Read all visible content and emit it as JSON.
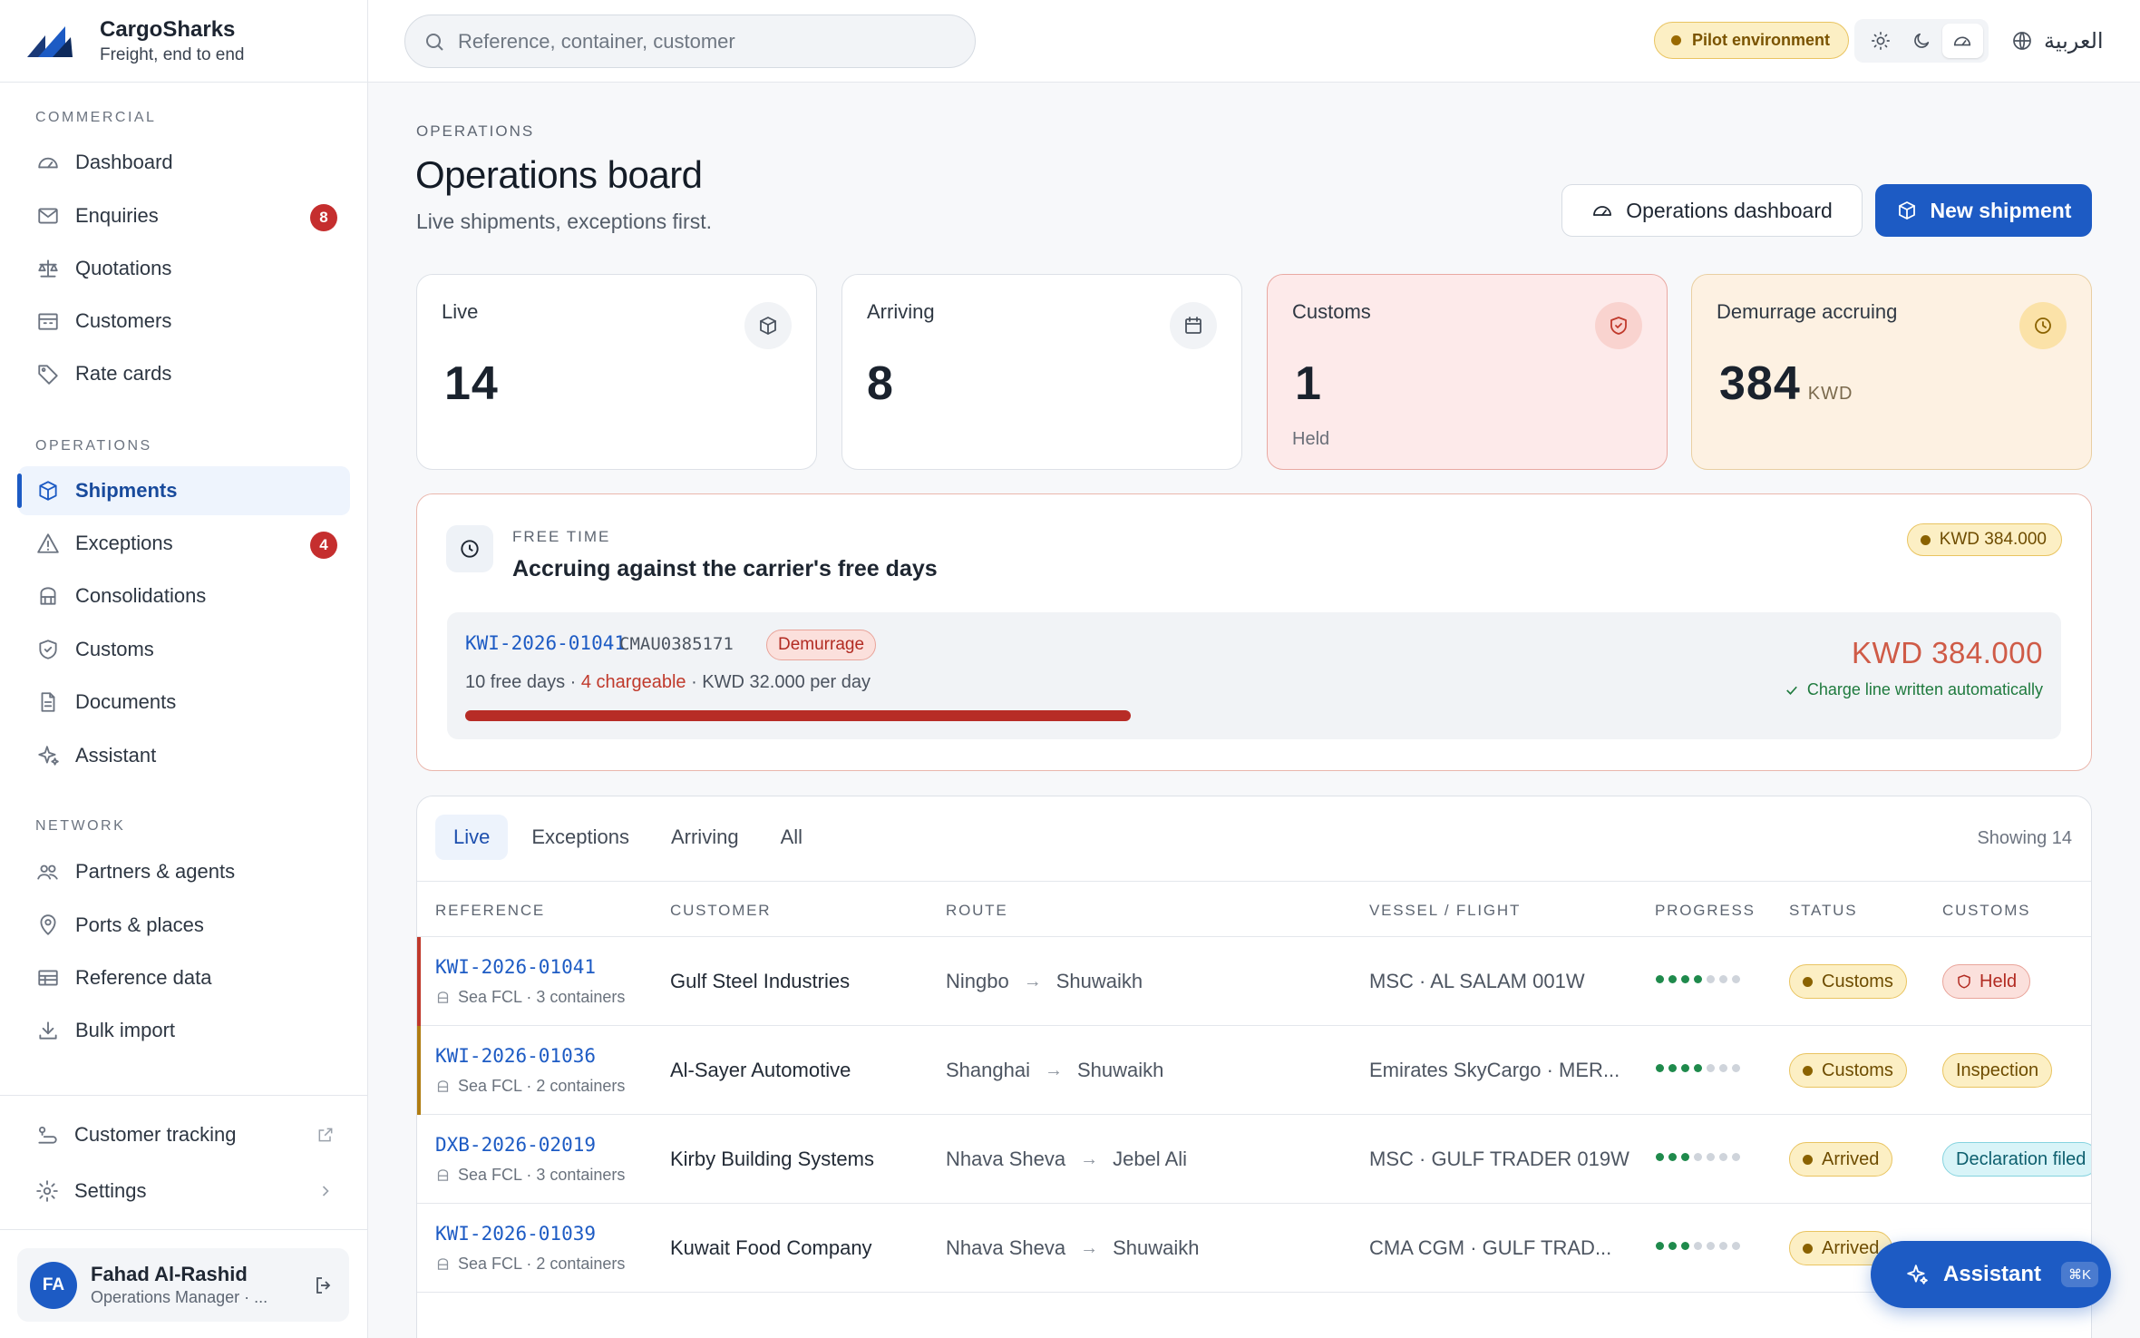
{
  "brand": {
    "name": "CargoSharks",
    "tagline": "Freight, end to end"
  },
  "search": {
    "placeholder": "Reference, container, customer"
  },
  "topbar": {
    "environment": "Pilot environment",
    "language": "العربية"
  },
  "sidebar": {
    "sections": [
      {
        "title": "COMMERCIAL",
        "items": [
          {
            "label": "Dashboard",
            "icon": "gauge-icon"
          },
          {
            "label": "Enquiries",
            "icon": "mail-icon",
            "badge": "8"
          },
          {
            "label": "Quotations",
            "icon": "scale-icon"
          },
          {
            "label": "Customers",
            "icon": "building-icon"
          },
          {
            "label": "Rate cards",
            "icon": "tag-icon"
          }
        ]
      },
      {
        "title": "OPERATIONS",
        "items": [
          {
            "label": "Shipments",
            "icon": "box-icon",
            "active": true
          },
          {
            "label": "Exceptions",
            "icon": "warning-icon",
            "badge": "4"
          },
          {
            "label": "Consolidations",
            "icon": "layers-icon"
          },
          {
            "label": "Customs",
            "icon": "shield-icon"
          },
          {
            "label": "Documents",
            "icon": "document-icon"
          },
          {
            "label": "Assistant",
            "icon": "sparkle-icon"
          }
        ]
      },
      {
        "title": "NETWORK",
        "items": [
          {
            "label": "Partners & agents",
            "icon": "users-icon"
          },
          {
            "label": "Ports & places",
            "icon": "pin-icon"
          },
          {
            "label": "Reference data",
            "icon": "table-icon"
          },
          {
            "label": "Bulk import",
            "icon": "download-icon"
          }
        ]
      }
    ],
    "footer": {
      "tracking": "Customer tracking",
      "settings": "Settings"
    },
    "user": {
      "initials": "FA",
      "name": "Fahad Al-Rashid",
      "role": "Operations Manager · ..."
    }
  },
  "page": {
    "eyebrow": "OPERATIONS",
    "title": "Operations board",
    "subtitle": "Live shipments, exceptions first.",
    "dashboard_button": "Operations dashboard",
    "new_button": "New shipment"
  },
  "stats": [
    {
      "label": "Live",
      "value": "14",
      "icon": "box-icon"
    },
    {
      "label": "Arriving",
      "value": "8",
      "icon": "calendar-icon"
    },
    {
      "label": "Customs",
      "value": "1",
      "sub": "Held",
      "icon": "shield-icon"
    },
    {
      "label": "Demurrage accruing",
      "value": "384",
      "unit": "KWD",
      "icon": "clock-icon"
    }
  ],
  "freetime": {
    "eyebrow": "FREE TIME",
    "title": "Accruing against the carrier's free days",
    "total": "KWD 384.000",
    "row": {
      "reference": "KWI-2026-01041",
      "container": "CMAU0385171",
      "tag": "Demurrage",
      "free_days": "10 free days",
      "chargeable": "4 chargeable",
      "rate": "KWD 32.000 per day",
      "amount": "KWD 384.000",
      "note": "Charge line written automatically"
    }
  },
  "table": {
    "tabs": [
      "Live",
      "Exceptions",
      "Arriving",
      "All"
    ],
    "active_tab": "Live",
    "showing": "Showing 14",
    "columns": [
      "REFERENCE",
      "CUSTOMER",
      "ROUTE",
      "VESSEL / FLIGHT",
      "PROGRESS",
      "STATUS",
      "CUSTOMS"
    ],
    "rows": [
      {
        "reference": "KWI-2026-01041",
        "meta": "Sea FCL · 3 containers",
        "customer": "Gulf Steel Industries",
        "origin": "Ningbo",
        "destination": "Shuwaikh",
        "vessel": "MSC · AL SALAM 001W",
        "progress_steps": 4,
        "total_steps": 7,
        "status": "Customs",
        "customs": "Held",
        "accent": "#c0392b"
      },
      {
        "reference": "KWI-2026-01036",
        "meta": "Sea FCL · 2 containers",
        "customer": "Al-Sayer Automotive",
        "origin": "Shanghai",
        "destination": "Shuwaikh",
        "vessel": "Emirates SkyCargo · MER...",
        "progress_steps": 4,
        "total_steps": 7,
        "status": "Customs",
        "customs": "Inspection",
        "accent": "#b07d12"
      },
      {
        "reference": "DXB-2026-02019",
        "meta": "Sea FCL · 3 containers",
        "customer": "Kirby Building Systems",
        "origin": "Nhava Sheva",
        "destination": "Jebel Ali",
        "vessel": "MSC · GULF TRADER 019W",
        "progress_steps": 3,
        "total_steps": 7,
        "status": "Arrived",
        "customs": "Declaration filed",
        "accent": ""
      },
      {
        "reference": "KWI-2026-01039",
        "meta": "Sea FCL · 2 containers",
        "customer": "Kuwait Food Company",
        "origin": "Nhava Sheva",
        "destination": "Shuwaikh",
        "vessel": "CMA CGM · GULF TRAD...",
        "progress_steps": 3,
        "total_steps": 7,
        "status": "Arrived",
        "customs": "",
        "accent": ""
      }
    ]
  },
  "assistant": {
    "label": "Assistant",
    "shortcut": "⌘K"
  },
  "colors": {
    "accent": "#1d5bc4",
    "danger": "#c52e2e",
    "warning": "#e9c461",
    "success": "#1f9d55"
  }
}
